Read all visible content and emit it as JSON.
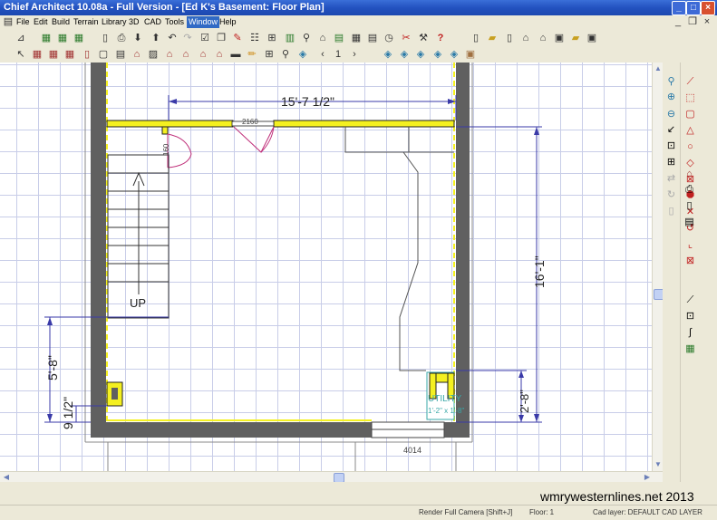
{
  "window": {
    "title": "Chief Architect 10.08a - Full Version - [Ed K's Basement: Floor Plan]"
  },
  "menu": [
    "File",
    "Edit",
    "Build",
    "Terrain",
    "Library",
    "3D",
    "CAD",
    "Tools",
    "Window",
    "Help"
  ],
  "menu_active": "Window",
  "plan": {
    "dim_top": "15'-7 1/2\"",
    "dim_right": "16'-1\"",
    "dim_left": "5'-8\"",
    "dim_left_small": "9 1/2\"",
    "dim_right_small": "2'-8\"",
    "door_label": "2160",
    "door_small_label": "160",
    "window_label": "4014",
    "stair_label": "UP",
    "utility_label": "UTILITY",
    "utility_size": "1'-2\" x 1'-8\""
  },
  "status": {
    "hint": "Render Full Camera [Shift+J]",
    "floor": "Floor: 1",
    "layer": "Cad layer:  DEFAULT CAD LAYER"
  },
  "watermark": "wmrywesternlines.net 2013",
  "colors": {
    "titlebar": "#2352c0",
    "wall": "#606060",
    "wall_highlight": "#f4f020",
    "grid": "#c8cde8",
    "dimension": "#3a3aa8",
    "door_arc": "#c0307a",
    "utility_text": "#3aa8a8"
  }
}
